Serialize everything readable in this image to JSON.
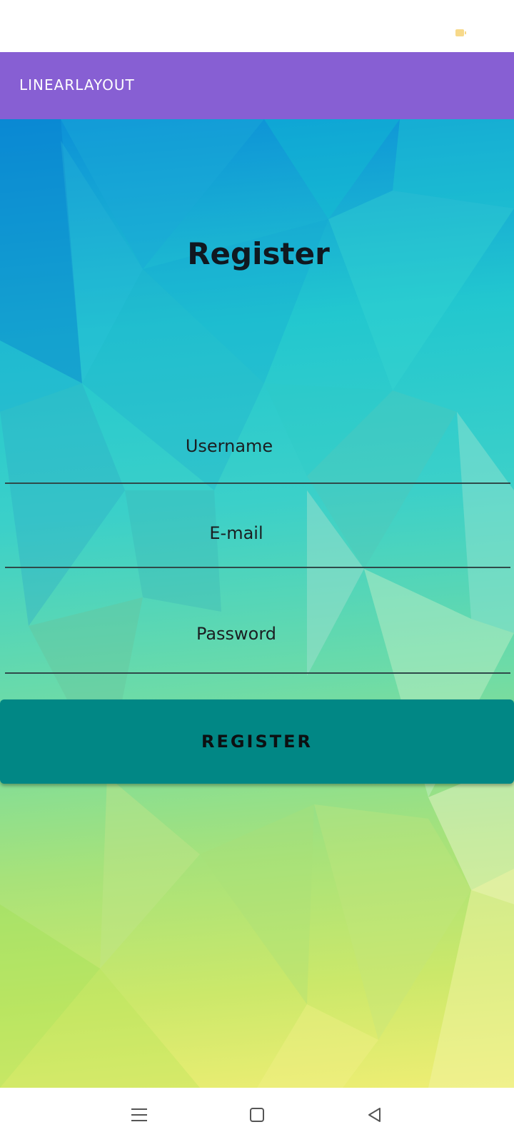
{
  "status_bar": {
    "icons": [
      "battery-icon"
    ],
    "battery_color": "#f7d98a"
  },
  "app_bar": {
    "title": "LINEARLAYOUT",
    "color": "#875fd3"
  },
  "form": {
    "title": "Register",
    "fields": {
      "username_placeholder": "Username",
      "email_placeholder": "E-mail",
      "password_placeholder": "Password"
    },
    "submit_label": "REGISTER",
    "submit_color": "#018785"
  },
  "nav_bar": {
    "icons": [
      "menu-icon",
      "home-icon",
      "back-icon"
    ]
  }
}
